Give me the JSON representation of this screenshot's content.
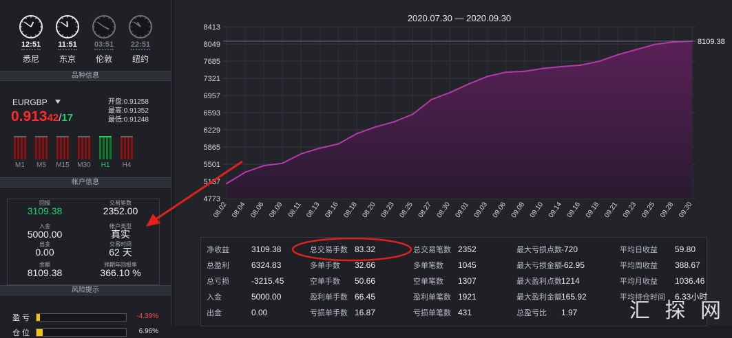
{
  "clocks": [
    {
      "time": "12:51",
      "city": "悉尼",
      "active": true,
      "h": 12.85,
      "m": 51
    },
    {
      "time": "11:51",
      "city": "东京",
      "active": true,
      "h": 11.85,
      "m": 51
    },
    {
      "time": "03:51",
      "city": "伦敦",
      "active": false,
      "h": 3.85,
      "m": 51
    },
    {
      "time": "22:51",
      "city": "纽约",
      "active": false,
      "h": 22.85,
      "m": 51
    }
  ],
  "sections": {
    "quote": "品种信息",
    "account": "帐户信息",
    "risk": "风险提示"
  },
  "quote": {
    "symbol": "EURGBP",
    "price_big": "0.913",
    "price_mid": "42",
    "slash": "/",
    "price_small": "17",
    "ohl": [
      {
        "k": "开盘:",
        "v": "0.91258"
      },
      {
        "k": "最高:",
        "v": "0.91352"
      },
      {
        "k": "最低:",
        "v": "0.91248"
      }
    ],
    "timeframes": [
      {
        "label": "M1",
        "up": false
      },
      {
        "label": "M5",
        "up": false
      },
      {
        "label": "M15",
        "up": false
      },
      {
        "label": "M30",
        "up": false
      },
      {
        "label": "H1",
        "up": true
      },
      {
        "label": "H4",
        "up": false
      }
    ]
  },
  "account": {
    "items": [
      {
        "k": "回报",
        "v": "3109.38",
        "green": true
      },
      {
        "k": "交易笔数",
        "v": "2352.00"
      },
      {
        "k": "入金",
        "v": "5000.00"
      },
      {
        "k": "帐户类型",
        "v": "真实"
      },
      {
        "k": "出金",
        "v": "0.00"
      },
      {
        "k": "交易时间",
        "v": "62 天"
      },
      {
        "k": "余额",
        "v": "8109.38"
      },
      {
        "k": "预期年回报率",
        "v": "366.10 %"
      }
    ]
  },
  "risk": [
    {
      "k": "盈 亏",
      "v": "-4.39%",
      "fill": 0.04,
      "color": "#ff4a4a"
    },
    {
      "k": "仓 位",
      "v": "6.96%",
      "fill": 0.07,
      "color": "#e8e8e8"
    }
  ],
  "chart_data": {
    "type": "area",
    "title": "2020.07.30 — 2020.09.30",
    "x": [
      "08.02",
      "08.04",
      "08.06",
      "08.09",
      "08.11",
      "08.13",
      "08.16",
      "08.18",
      "08.20",
      "08.23",
      "08.25",
      "08.27",
      "08.30",
      "09.01",
      "09.03",
      "09.06",
      "09.08",
      "09.10",
      "09.14",
      "09.16",
      "09.18",
      "09.21",
      "09.23",
      "09.25",
      "09.28",
      "09.30"
    ],
    "y": [
      5090,
      5330,
      5470,
      5520,
      5720,
      5840,
      5930,
      6150,
      6290,
      6400,
      6560,
      6870,
      7020,
      7200,
      7360,
      7450,
      7470,
      7530,
      7570,
      7600,
      7680,
      7820,
      7930,
      8040,
      8090,
      8109.38
    ],
    "yticks": [
      4773,
      5137,
      5501,
      5865,
      6229,
      6593,
      6957,
      7321,
      7685,
      8049,
      8413
    ],
    "ylim": [
      4773,
      8413
    ],
    "last_label": "8109.38",
    "colors": {
      "line": "#b53aa8",
      "fill_top": "#5a2158",
      "fill_bottom": "#2a1a30"
    }
  },
  "stats": [
    [
      {
        "k": "净收益",
        "v": "3109.38"
      },
      {
        "k": "总盈利",
        "v": "6324.83"
      },
      {
        "k": "总亏损",
        "v": "-3215.45"
      },
      {
        "k": "入金",
        "v": "5000.00"
      },
      {
        "k": "出金",
        "v": "0.00"
      }
    ],
    [
      {
        "k": "总交易手数",
        "v": "83.32"
      },
      {
        "k": "多单手数",
        "v": "32.66"
      },
      {
        "k": "空单手数",
        "v": "50.66"
      },
      {
        "k": "盈利单手数",
        "v": "66.45"
      },
      {
        "k": "亏损单手数",
        "v": "16.87"
      }
    ],
    [
      {
        "k": "总交易笔数",
        "v": "2352"
      },
      {
        "k": "多单笔数",
        "v": "1045"
      },
      {
        "k": "空单笔数",
        "v": "1307"
      },
      {
        "k": "盈利单笔数",
        "v": "1921"
      },
      {
        "k": "亏损单笔数",
        "v": "431"
      }
    ],
    [
      {
        "k": "最大亏损点数",
        "v": "-720"
      },
      {
        "k": "最大亏损金额",
        "v": "-62.95"
      },
      {
        "k": "最大盈利点数",
        "v": "1214"
      },
      {
        "k": "最大盈利金额",
        "v": "165.92"
      },
      {
        "k": "总盈亏比",
        "v": "1.97"
      }
    ],
    [
      {
        "k": "平均日收益",
        "v": "59.80"
      },
      {
        "k": "平均周收益",
        "v": "388.67"
      },
      {
        "k": "平均月收益",
        "v": "1036.46"
      },
      {
        "k": "平均持仓时间",
        "v": "6.33小时"
      },
      {
        "k": "",
        "v": ""
      }
    ]
  ],
  "watermark": "汇 探 网"
}
